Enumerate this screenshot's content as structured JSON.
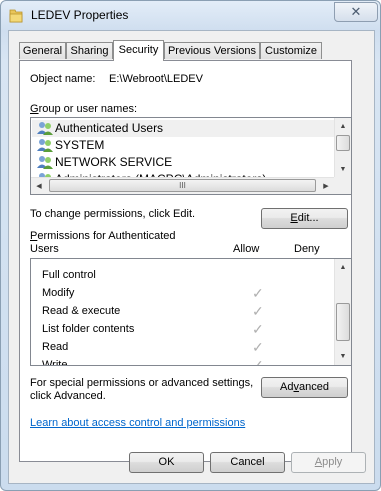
{
  "window": {
    "title": "LEDEV Properties",
    "icon": "folder-icon",
    "close_glyph": "✕"
  },
  "tabs": [
    {
      "label": "General",
      "active": false
    },
    {
      "label": "Sharing",
      "active": false
    },
    {
      "label": "Security",
      "active": true
    },
    {
      "label": "Previous Versions",
      "active": false
    },
    {
      "label": "Customize",
      "active": false
    }
  ],
  "security": {
    "object_name_label": "Object name:",
    "object_name_value": "E:\\Webroot\\LEDEV",
    "group_label": "Group or user names:",
    "groups": [
      {
        "name": "Authenticated Users",
        "icon": "users-icon",
        "selected": true
      },
      {
        "name": "SYSTEM",
        "icon": "users-icon",
        "selected": false
      },
      {
        "name": "NETWORK SERVICE",
        "icon": "users-icon",
        "selected": false
      },
      {
        "name": "Administrators (MACPC\\Administrators)",
        "icon": "users-icon",
        "selected": false
      }
    ],
    "hscroll_grip": "III",
    "change_text": "To change permissions, click Edit.",
    "edit_button": "Edit...",
    "permissions_label_line1": "Permissions for Authenticated",
    "permissions_label_line2": "Users",
    "allow_header": "Allow",
    "deny_header": "Deny",
    "permissions": [
      {
        "name": "Full control",
        "allow": false,
        "deny": false
      },
      {
        "name": "Modify",
        "allow": true,
        "deny": false
      },
      {
        "name": "Read & execute",
        "allow": true,
        "deny": false
      },
      {
        "name": "List folder contents",
        "allow": true,
        "deny": false
      },
      {
        "name": "Read",
        "allow": true,
        "deny": false
      },
      {
        "name": "Write",
        "allow": true,
        "deny": false
      }
    ],
    "check_glyph": "✓",
    "special_text_line1": "For special permissions or advanced settings,",
    "special_text_line2": "click Advanced.",
    "advanced_button": "Advanced",
    "learn_link": "Learn about access control and permissions"
  },
  "footer": {
    "ok": "OK",
    "cancel": "Cancel",
    "apply": "Apply"
  }
}
